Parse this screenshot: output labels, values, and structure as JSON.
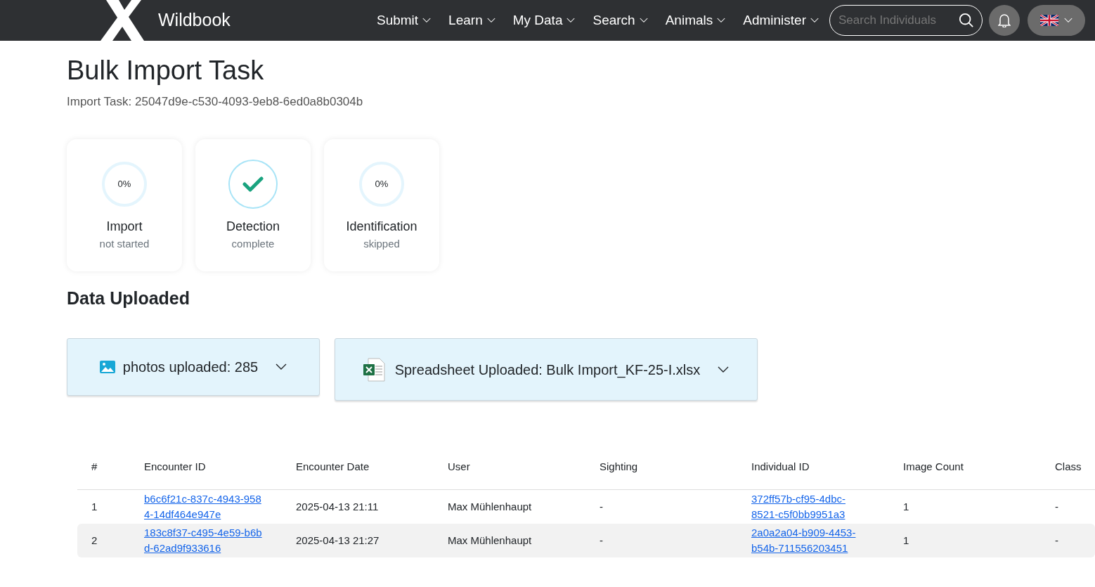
{
  "navbar": {
    "brand": "Wildbook",
    "menu": [
      "Submit",
      "Learn",
      "My Data",
      "Search",
      "Animals",
      "Administer"
    ],
    "search": {
      "placeholder": "Search Individuals"
    }
  },
  "page": {
    "title": "Bulk Import Task",
    "subtitle": "Import Task: 25047d9e-c530-4093-9eb8-6ed0a8b0304b"
  },
  "status_cards": [
    {
      "kind": "progress",
      "percent": "0%",
      "label": "Import",
      "status": "not started"
    },
    {
      "kind": "complete",
      "label": "Detection",
      "status": "complete"
    },
    {
      "kind": "progress",
      "percent": "0%",
      "label": "Identification",
      "status": "skipped"
    }
  ],
  "data_uploaded": {
    "title": "Data Uploaded",
    "panels": [
      {
        "kind": "photos",
        "label": "photos uploaded: 285"
      },
      {
        "kind": "spreadsheet",
        "label": "Spreadsheet Uploaded: Bulk Import_KF-25-I.xlsx"
      }
    ]
  },
  "table": {
    "columns": [
      "#",
      "Encounter ID",
      "Encounter Date",
      "User",
      "Sighting",
      "Individual ID",
      "Image Count",
      "Class"
    ],
    "rows": [
      [
        "1",
        "b6c6f21c-837c-4943-9584-14df464e947e",
        "2025-04-13 21:11",
        "Max Mühlenhaupt",
        "-",
        "372ff57b-cf95-4dbc-8521-c5f0bb9951a3",
        "1",
        "-"
      ],
      [
        "2",
        "183c8f37-c495-4e59-b6bd-62ad9f933616",
        "2025-04-13 21:27",
        "Max Mühlenhaupt",
        "-",
        "2a0a2a04-b909-4453-b54b-711556203451",
        "1",
        "-"
      ]
    ]
  }
}
